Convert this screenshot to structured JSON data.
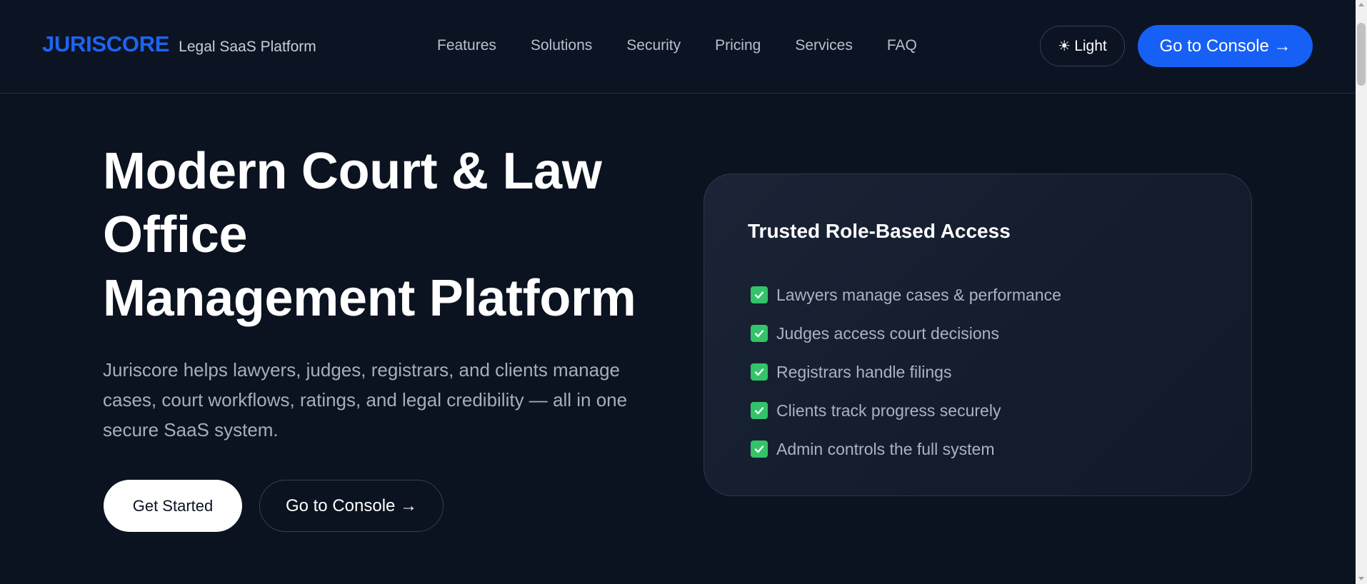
{
  "header": {
    "brand_name": "JURISCORE",
    "brand_tagline": "Legal SaaS Platform",
    "nav": [
      {
        "label": "Features"
      },
      {
        "label": "Solutions"
      },
      {
        "label": "Security"
      },
      {
        "label": "Pricing"
      },
      {
        "label": "Services"
      },
      {
        "label": "FAQ"
      }
    ],
    "theme_toggle": {
      "icon": "sun-icon",
      "label": "Light"
    },
    "console_button": "Go to Console →"
  },
  "hero": {
    "title_lines": [
      "Modern Court & Law",
      "Office",
      "Management Platform"
    ],
    "description": "Juriscore helps lawyers, judges, registrars, and clients manage cases, court workflows, ratings, and legal credibility — all in one secure SaaS system.",
    "primary_button": "Get Started",
    "secondary_button": "Go to Console →"
  },
  "card": {
    "title": "Trusted Role-Based Access",
    "items": [
      {
        "label": "Lawyers manage cases & performance"
      },
      {
        "label": "Judges access court decisions"
      },
      {
        "label": "Registrars handle filings"
      },
      {
        "label": "Clients track progress securely"
      },
      {
        "label": "Admin controls the full system"
      }
    ]
  },
  "colors": {
    "background": "#0b1220",
    "brand": "#1d64f2",
    "accent_button": "#1660f5",
    "check": "#33c46a"
  }
}
